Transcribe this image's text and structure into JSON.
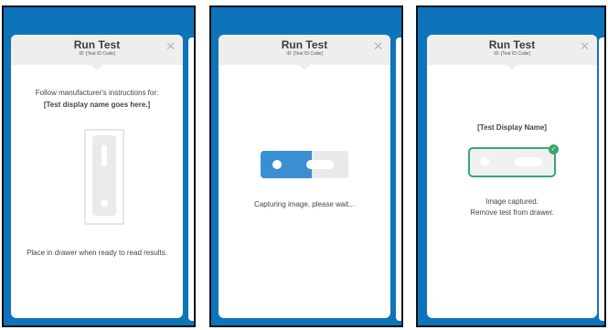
{
  "panels": [
    {
      "title": "Run Test",
      "subtitle": "ID: [Test ID Code]",
      "instruction": "Follow manufacturer's instructions for:",
      "test_name": "[Test display name goes here.]",
      "footer": "Place in drawer when ready to read results."
    },
    {
      "title": "Run Test",
      "subtitle": "ID: [Test ID Code]",
      "status": "Capturing image, please wait...",
      "progress": 0.58
    },
    {
      "title": "Run Test",
      "subtitle": "ID: [Test ID Code]",
      "test_name": "[Test Display Name]",
      "status_line1": "Image captured.",
      "status_line2": "Remove test from drawer."
    }
  ],
  "icons": {
    "close": "close-icon",
    "check": "check-icon"
  },
  "colors": {
    "frame": "#0d74bb",
    "progress": "#3a8fd3",
    "success": "#3aa76d",
    "header": "#eeeeee"
  }
}
